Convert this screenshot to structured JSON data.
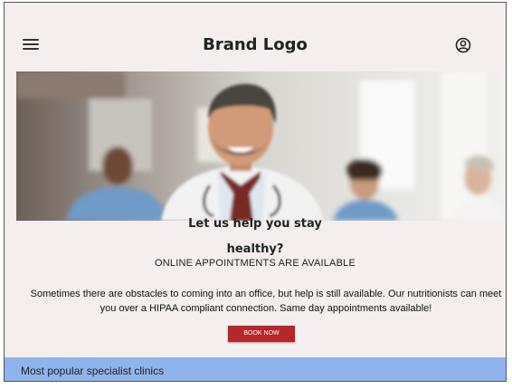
{
  "header": {
    "brand": "Brand Logo",
    "menu_icon": "hamburger-menu-icon",
    "account_icon": "account-circle-icon"
  },
  "hero": {
    "image": "doctor-and-team-photo"
  },
  "content": {
    "heading_line1": "Let us help you stay",
    "heading_line2": "healthy?",
    "subheading": "ONLINE APPOINTMENTS ARE AVAILABLE",
    "body": "Sometimes there are obstacles to coming into an office, but help is still available. Our nutritionists can meet you over a HIPAA compliant connection. Same day appointments available!",
    "button_label": "BOOK NOW"
  },
  "footer": {
    "label": "Most popular specialist clinics"
  },
  "colors": {
    "background": "#f4efee",
    "button": "#b4272a",
    "footer": "#8fb3ec"
  }
}
